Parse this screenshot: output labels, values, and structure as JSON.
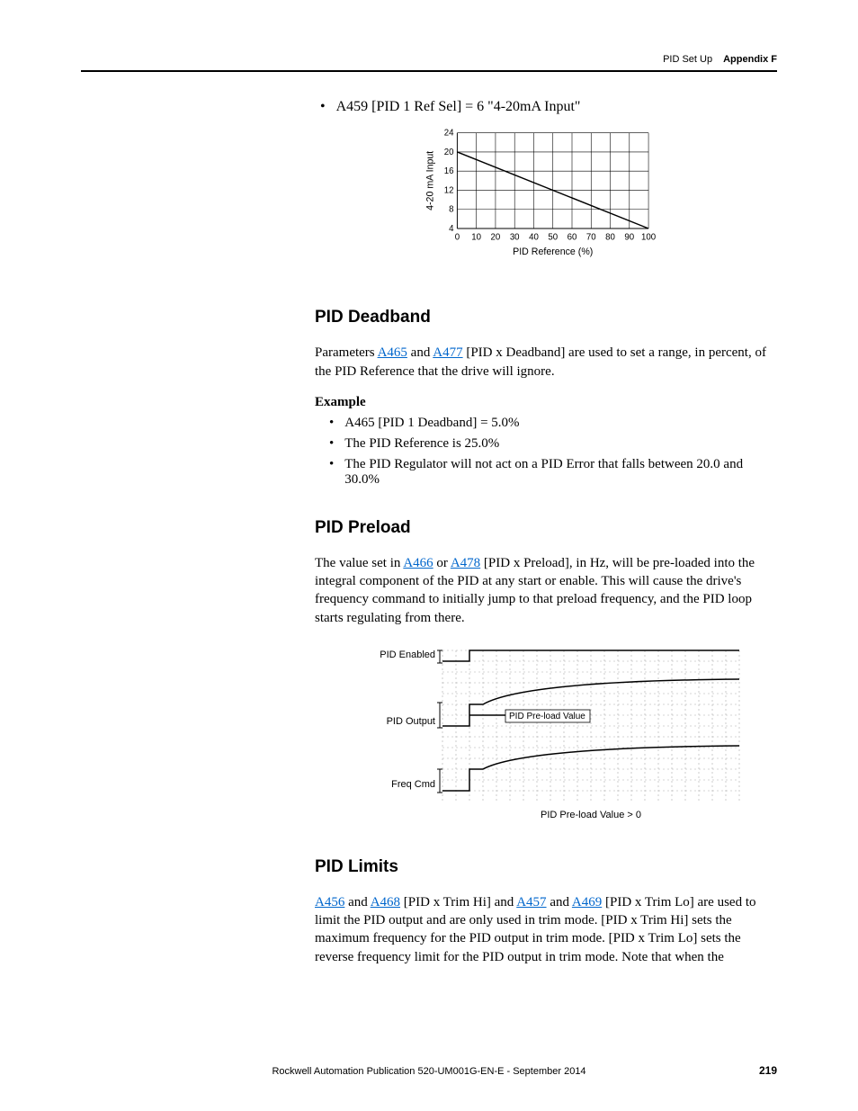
{
  "header": {
    "title": "PID Set Up",
    "appendix": "Appendix F"
  },
  "top_bullet": {
    "text": "A459 [PID 1 Ref Sel] = 6 \"4-20mA Input\""
  },
  "chart_data": {
    "type": "line",
    "title": "",
    "xlabel": "PID Reference (%)",
    "ylabel": "4-20 mA Input",
    "x": [
      0,
      10,
      20,
      30,
      40,
      50,
      60,
      70,
      80,
      90,
      100
    ],
    "xlim": [
      0,
      100
    ],
    "ylim": [
      4,
      24
    ],
    "yticks": [
      4,
      8,
      12,
      16,
      20,
      24
    ],
    "series": [
      {
        "name": "4-20mA",
        "values": [
          20,
          18.4,
          16.8,
          15.2,
          13.6,
          12,
          10.4,
          8.8,
          7.2,
          5.6,
          4
        ]
      }
    ]
  },
  "deadband": {
    "heading": "PID Deadband",
    "para_parts": {
      "a": "Parameters ",
      "link1": "A465",
      "b": " and ",
      "link2": "A477",
      "c": " [PID x Deadband] are used to set a range, in percent, of the PID Reference that the drive will ignore."
    },
    "example_label": "Example",
    "bullets": [
      "A465 [PID 1 Deadband] = 5.0%",
      "The PID Reference is 25.0%",
      "The PID Regulator will not act on a PID Error that falls between 20.0 and 30.0%"
    ]
  },
  "preload": {
    "heading": "PID Preload",
    "para_parts": {
      "a": "The value set in ",
      "link1": "A466",
      "b": " or ",
      "link2": "A478",
      "c": " [PID x Preload], in Hz, will be pre-loaded into the integral component of the PID at any start or enable. This will cause the drive's frequency command to initially jump to that preload frequency, and the PID loop starts regulating from there."
    },
    "diagram": {
      "labels": {
        "enabled": "PID Enabled",
        "output": "PID Output",
        "freq": "Freq Cmd"
      },
      "annotation": "PID Pre-load Value",
      "caption": "PID Pre-load Value > 0"
    }
  },
  "limits": {
    "heading": "PID Limits",
    "para_parts": {
      "link1": "A456",
      "a": " and ",
      "link2": "A468",
      "b": " [PID x Trim Hi] and ",
      "link3": "A457",
      "c": " and ",
      "link4": "A469",
      "d": " [PID x Trim Lo] are used to limit the PID output and are only used in trim mode. [PID x Trim Hi] sets the maximum frequency for the PID output in trim mode. [PID x Trim Lo] sets the reverse frequency limit for the PID output in trim mode. Note that when the"
    }
  },
  "footer": {
    "pub": "Rockwell Automation Publication 520-UM001G-EN-E - September 2014",
    "page": "219"
  }
}
